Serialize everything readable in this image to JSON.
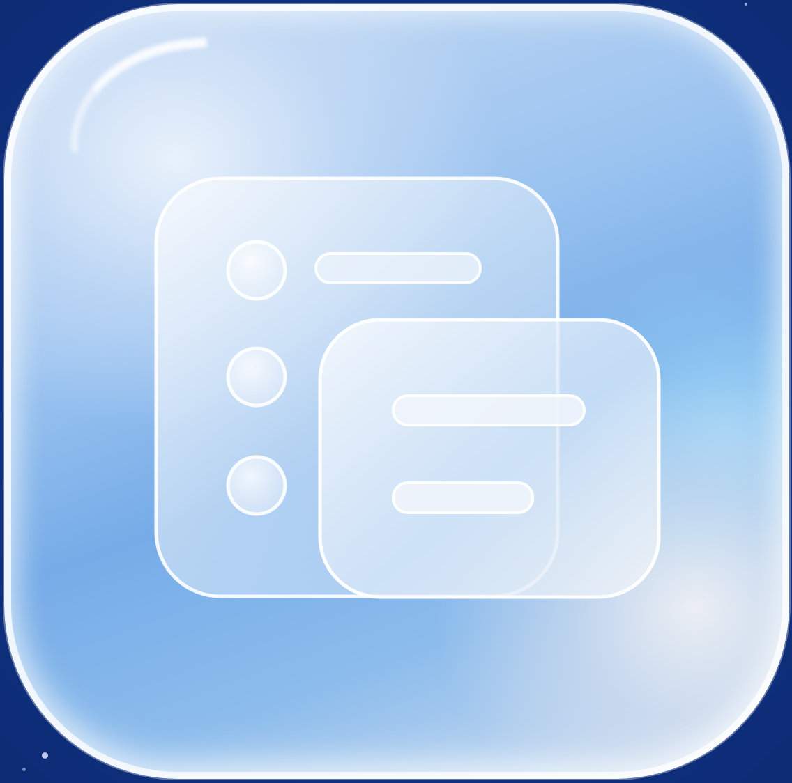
{
  "app_icon": {
    "icon_name": "list-and-note-icon",
    "colors": {
      "background": "#0f2f7e",
      "tile": "#8cbcec",
      "glyph": "#ffffff"
    }
  }
}
